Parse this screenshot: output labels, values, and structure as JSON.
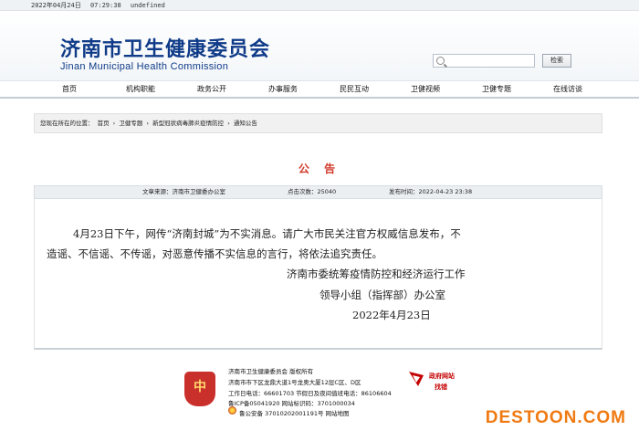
{
  "topbar": {
    "date": "2022年04月24日",
    "time": "07:29:38",
    "extra": "undefined"
  },
  "header": {
    "title": "济南市卫生健康委员会",
    "subtitle": "Jinan Municipal Health Commission",
    "search": {
      "placeholder": "",
      "button_label": "检索"
    }
  },
  "nav": {
    "items": [
      "首页",
      "机构职能",
      "政务公开",
      "办事服务",
      "民民互动",
      "卫健视频",
      "卫健专题",
      "在线访谈"
    ]
  },
  "breadcrumb": {
    "prefix": "您现在所在的位置：",
    "items": [
      "首页",
      "卫健专题",
      "新型冠状病毒肺炎疫情防控",
      "通知公告"
    ],
    "separator": "›"
  },
  "notice": {
    "title": "公 告",
    "source": "文章来源：济南市卫健委办公室",
    "views": "点击次数：25040",
    "published": "发布时间：2022-04-23 23:38",
    "para1_line1": "4月23日下午，网传“济南封城”为不实消息。请广大市民关注官方权威信息发布，不",
    "para1_line2": "造谣、不信谣、不传谣，对恶意传播不实信息的言行，将依法追究责任。",
    "signature_line1": "济南市委统筹疫情防控和经济运行工作",
    "signature_line2": "领导小组（指挥部）办公室",
    "date": "2022年4月23日"
  },
  "footer": {
    "line1": "济南市卫生健康委员会  版权所有",
    "line2": "济南市市下区龙鼎大道1号龙奥大厦12层C区、D区",
    "line3": "工作日电话：66601703  节假日及夜间值班电话：86106604",
    "line4": "鲁ICP备05041920  网站标识码：3701000034",
    "line5": "鲁公安备 37010202001191号  网站地图",
    "gov_badge_line1": "政府网站",
    "gov_badge_line2": "找错"
  },
  "watermark": "DESTOON.COM",
  "colors": {
    "brand_blue": "#0f3b88",
    "notice_red": "#d23a2a",
    "watermark_orange": "#f07a12"
  }
}
